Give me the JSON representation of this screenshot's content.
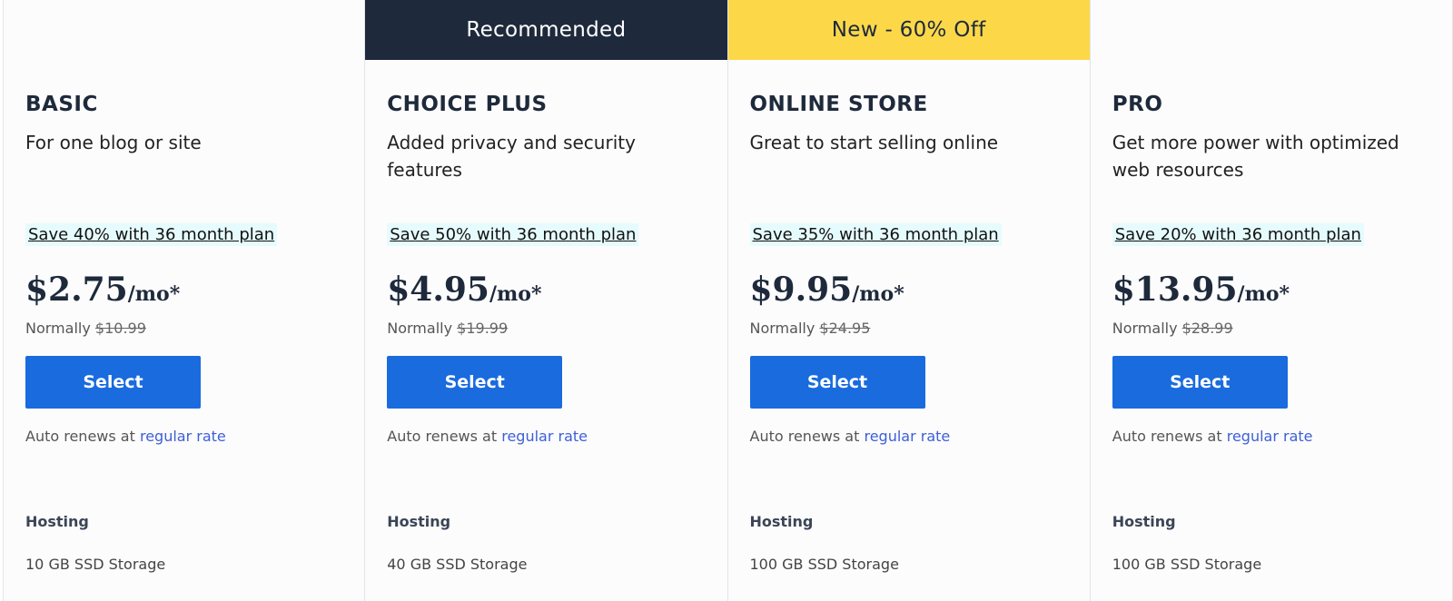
{
  "plans": [
    {
      "banner": "",
      "name": "BASIC",
      "desc": "For one blog or site",
      "save": "Save 40% with 36 month plan",
      "price": "$2.75",
      "unit": "/mo*",
      "normally": "Normally",
      "old_price": "$10.99",
      "select": "Select",
      "renew": "Auto renews at",
      "renew_link": "regular rate",
      "feature_heading": "Hosting",
      "feature": "10 GB SSD Storage"
    },
    {
      "banner": "Recommended",
      "name": "CHOICE PLUS",
      "desc": "Added privacy and security features",
      "save": "Save 50% with 36 month plan",
      "price": "$4.95",
      "unit": "/mo*",
      "normally": "Normally",
      "old_price": "$19.99",
      "select": "Select",
      "renew": "Auto renews at",
      "renew_link": "regular rate",
      "feature_heading": "Hosting",
      "feature": "40 GB SSD Storage"
    },
    {
      "banner": "New - 60% Off",
      "name": "ONLINE STORE",
      "desc": "Great to start selling online",
      "save": "Save 35% with 36 month plan",
      "price": "$9.95",
      "unit": "/mo*",
      "normally": "Normally",
      "old_price": "$24.95",
      "select": "Select",
      "renew": "Auto renews at",
      "renew_link": "regular rate",
      "feature_heading": "Hosting",
      "feature": "100 GB SSD Storage"
    },
    {
      "banner": "",
      "name": "PRO",
      "desc": "Get more power with optimized web resources",
      "save": "Save 20% with 36 month plan",
      "price": "$13.95",
      "unit": "/mo*",
      "normally": "Normally",
      "old_price": "$28.99",
      "select": "Select",
      "renew": "Auto renews at",
      "renew_link": "regular rate",
      "feature_heading": "Hosting",
      "feature": "100 GB SSD Storage"
    }
  ],
  "colors": {
    "accent": "#196bde",
    "recommended_banner": "#1e293b",
    "sale_banner": "#fcd849",
    "save_highlight": "#e6fbfd"
  }
}
